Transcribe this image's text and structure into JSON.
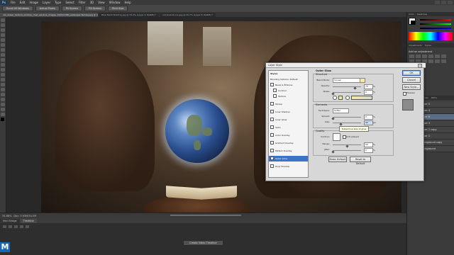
{
  "app": {
    "logo": "Ps",
    "menu": [
      "File",
      "Edit",
      "Image",
      "Layer",
      "Type",
      "Select",
      "Filter",
      "3D",
      "View",
      "Window",
      "Help"
    ]
  },
  "options_bar": {
    "buttons": [
      "Scroll All Windows",
      "Actual Pixels",
      "Fit Screen",
      "Fill Screen",
      "Print Size"
    ]
  },
  "doc_tabs": [
    {
      "label": "old_eraser_fantom_window_chair_window_images_1920x1080_wallpaper-fantasy.jpg @ 34.7% (Layer 8, RGB/8) *",
      "active": true
    },
    {
      "label": "Blue Earth Shading.jpg @ 33.3% (Layer 4, RGB/8) *",
      "active": false
    },
    {
      "label": "old-book-8-one.jpg @ 20.7% (Layer 8, RGB/8) *",
      "active": false
    }
  ],
  "status": {
    "zoom": "34.68%",
    "doc": "Doc: 5.93M/34.0M"
  },
  "timeline": {
    "tabs": [
      {
        "label": "Mini Bridge",
        "active": false
      },
      {
        "label": "Timeline",
        "active": true
      }
    ],
    "create_button": "Create Video Timeline"
  },
  "right_panels": {
    "top_tabs": [
      "Color",
      "Swatches"
    ],
    "adj_tabs": [
      "Adjustments",
      "Styles"
    ],
    "adj_title": "Add an adjustment",
    "layers_tabs": [
      "Layers",
      "Channels",
      "Paths"
    ],
    "layers": [
      {
        "name": "Layer 5",
        "active": false
      },
      {
        "name": "Layer 4",
        "active": false
      },
      {
        "name": "Layer 6",
        "active": true
      },
      {
        "name": "Layer 3",
        "active": false
      },
      {
        "name": "Layer 1 copy",
        "active": false
      },
      {
        "name": "Layer 1",
        "active": false
      },
      {
        "name": "Background copy",
        "active": false
      },
      {
        "name": "Background",
        "active": false
      }
    ]
  },
  "dialog": {
    "title": "Layer Style",
    "styles_header": "Styles",
    "blending": "Blending Options: Default",
    "styles": [
      {
        "label": "Bevel & Emboss",
        "checked": false,
        "selected": false
      },
      {
        "label": "Contour",
        "checked": false,
        "selected": false,
        "indent": true
      },
      {
        "label": "Texture",
        "checked": false,
        "selected": false,
        "indent": true
      },
      {
        "label": "Stroke",
        "checked": false,
        "selected": false
      },
      {
        "label": "Inner Shadow",
        "checked": false,
        "selected": false
      },
      {
        "label": "Inner Glow",
        "checked": false,
        "selected": false
      },
      {
        "label": "Satin",
        "checked": false,
        "selected": false
      },
      {
        "label": "Color Overlay",
        "checked": false,
        "selected": false
      },
      {
        "label": "Gradient Overlay",
        "checked": false,
        "selected": false
      },
      {
        "label": "Pattern Overlay",
        "checked": false,
        "selected": false
      },
      {
        "label": "Outer Glow",
        "checked": true,
        "selected": true
      },
      {
        "label": "Drop Shadow",
        "checked": false,
        "selected": false
      }
    ],
    "outer_glow_title": "Outer Glow",
    "structure_title": "Structure",
    "blend_mode_label": "Blend Mode:",
    "blend_mode_value": "Screen",
    "opacity_label": "Opacity:",
    "opacity_value": "75",
    "noise_label": "Noise:",
    "noise_value": "0",
    "elements_title": "Elements",
    "technique_label": "Technique:",
    "technique_value": "Softer",
    "spread_label": "Spread:",
    "spread_value": "0",
    "size_label": "Size:",
    "size_value": "90",
    "size_unit": "px",
    "quality_title": "Quality",
    "contour_label": "Contour:",
    "anti_aliased": "Anti-aliased",
    "range_label": "Range:",
    "range_value": "50",
    "jitter_label": "Jitter:",
    "jitter_value": "0",
    "pct": "%",
    "make_default": "Make Default",
    "reset_default": "Reset to Default",
    "ok": "OK",
    "cancel": "Cancel",
    "new_style": "New Style...",
    "preview": "Preview",
    "tooltip": "Determine size of glow"
  }
}
